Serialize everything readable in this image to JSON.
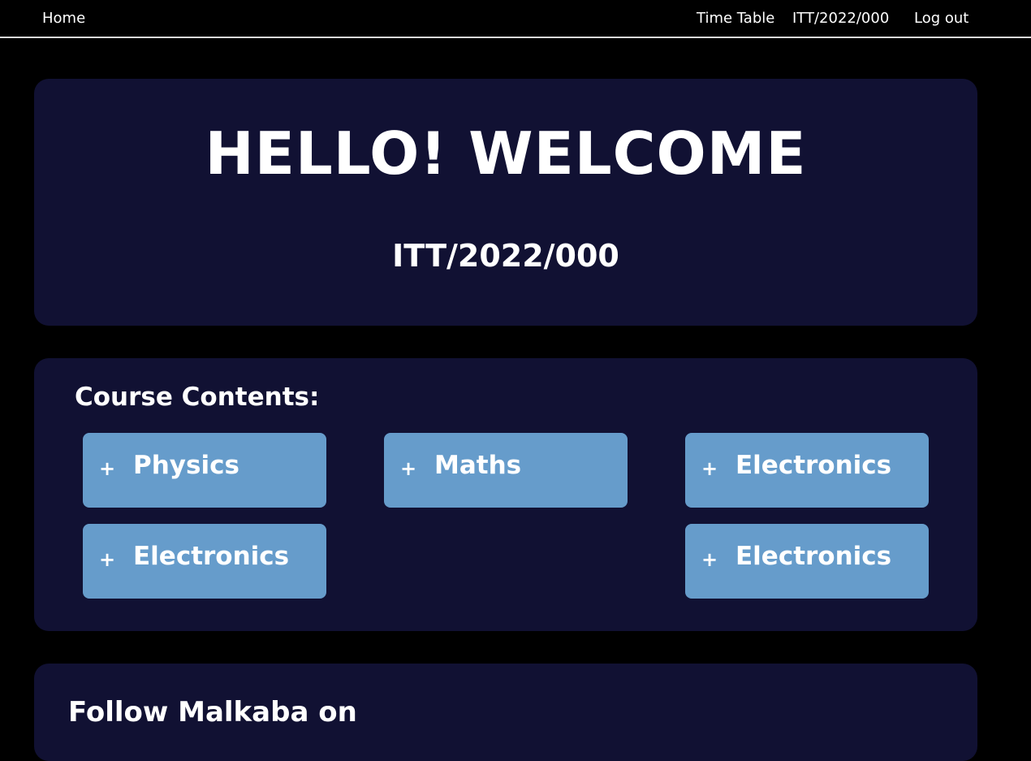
{
  "nav": {
    "home": "Home",
    "timetable": "Time Table",
    "user_id": "ITT/2022/000",
    "logout": "Log out"
  },
  "welcome": {
    "title": "HELLO! WELCOME",
    "user_id": "ITT/2022/000"
  },
  "courses": {
    "heading": "Course Contents:",
    "expand_icon": "+",
    "items": [
      {
        "label": "Physics"
      },
      {
        "label": "Maths"
      },
      {
        "label": "Electronics"
      },
      {
        "label": "Electronics"
      },
      {
        "label": "Electronics"
      }
    ]
  },
  "follow": {
    "heading": "Follow Malkaba on"
  },
  "colors": {
    "background": "#000000",
    "card": "#111133",
    "course_button": "#669ccb",
    "text": "#ffffff"
  }
}
